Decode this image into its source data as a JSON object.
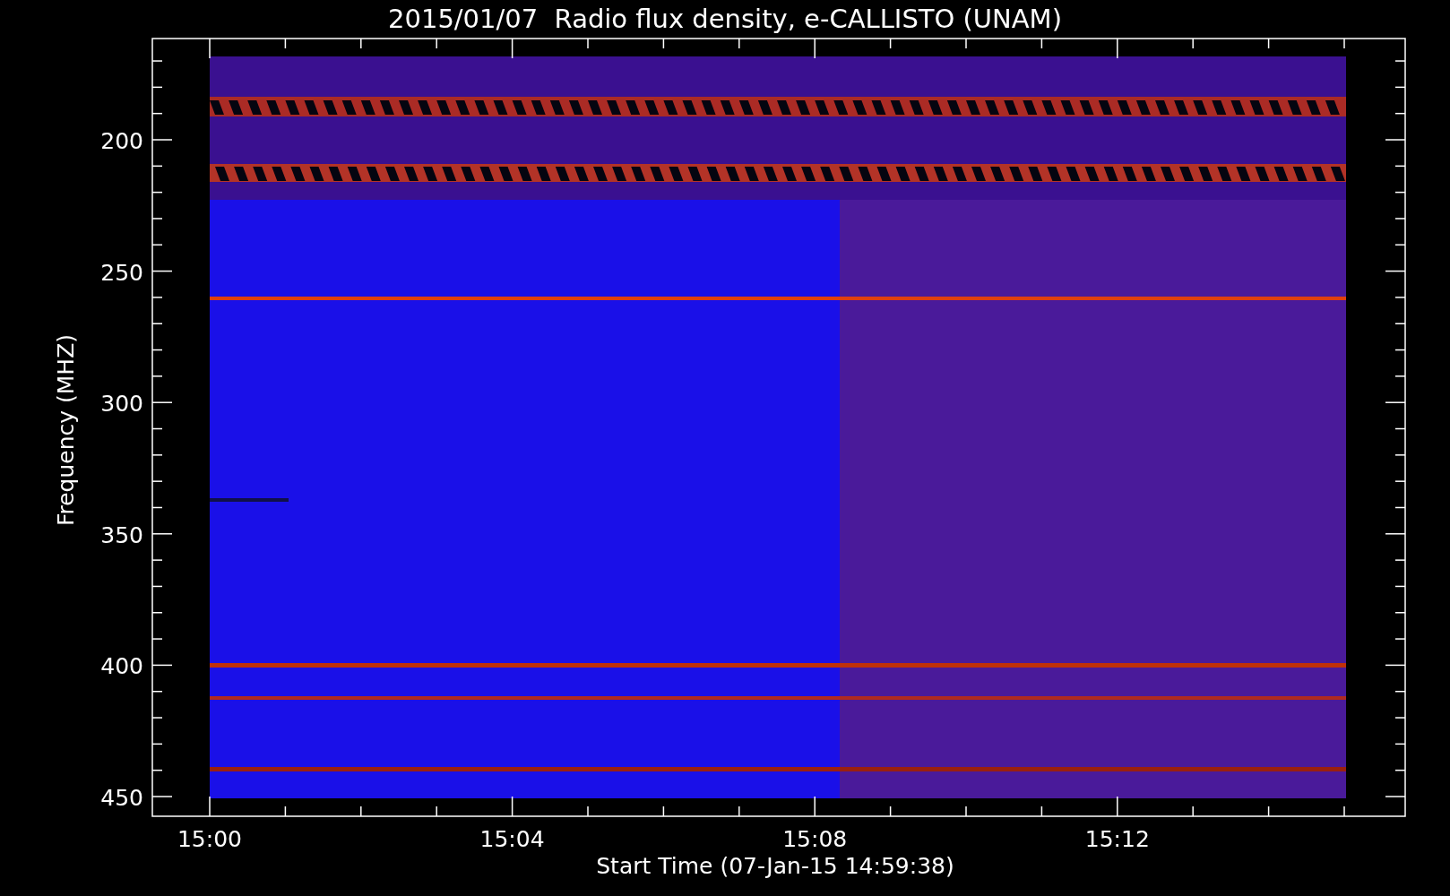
{
  "title": "2015/01/07  Radio flux density, e-CALLISTO (UNAM)",
  "y_axis": {
    "label": "Frequency (MHZ)",
    "ticks": [
      "200",
      "250",
      "300",
      "350",
      "400",
      "450"
    ]
  },
  "x_axis": {
    "label": "Start Time (07-Jan-15 14:59:38)",
    "ticks": [
      "15:00",
      "15:04",
      "15:08",
      "15:12"
    ]
  }
}
